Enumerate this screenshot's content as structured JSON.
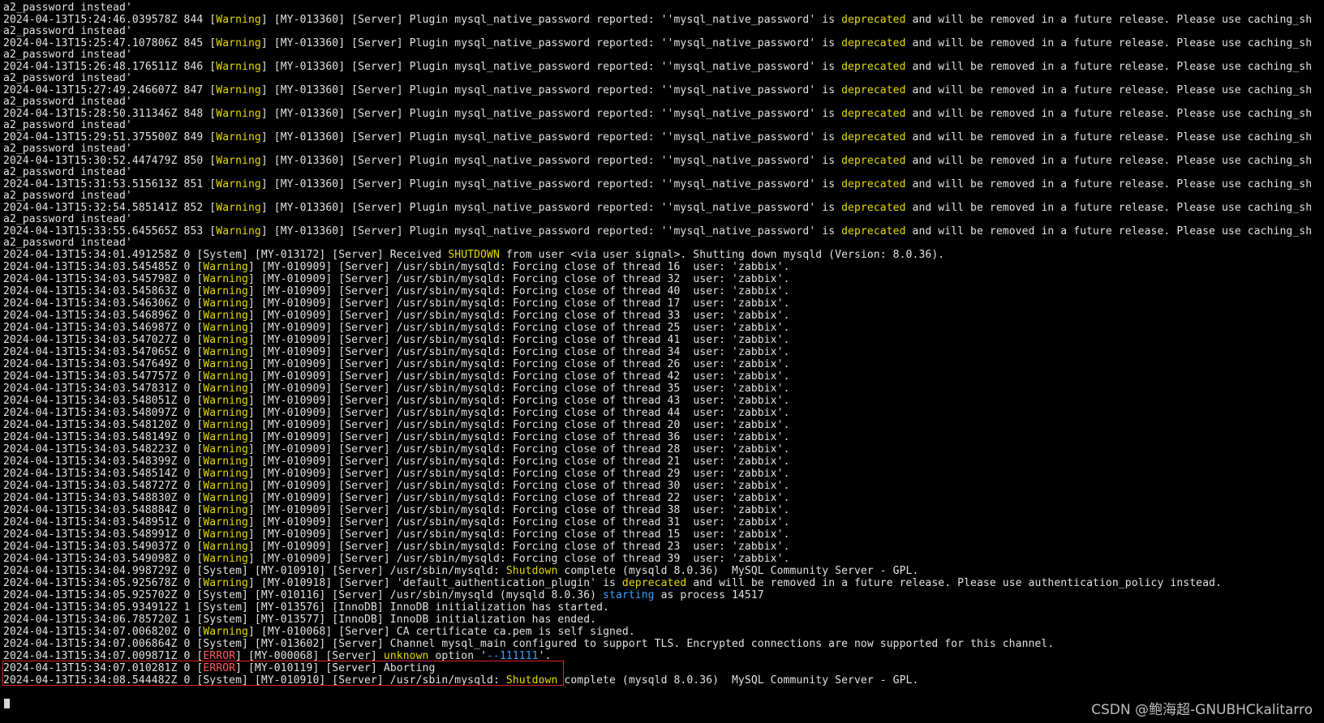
{
  "terminal": {
    "lines": [
      {
        "t": "a2_password instead'"
      },
      {
        "t": "2024-04-13T15:24:46.039578Z 844 [",
        "lvl": "Warning",
        "mid": "] [MY-013360] [Server] Plugin mysql_native_password reported: ''mysql_native_password' is ",
        "kw": "deprecated",
        "kwc": "y",
        "end": " and will be removed in a future release. Please use caching_sh",
        "wrap": true
      },
      {
        "t": "a2_password instead'"
      },
      {
        "t": "2024-04-13T15:25:47.107806Z 845 [",
        "lvl": "Warning",
        "mid": "] [MY-013360] [Server] Plugin mysql_native_password reported: ''mysql_native_password' is ",
        "kw": "deprecated",
        "kwc": "y",
        "end": " and will be removed in a future release. Please use caching_sh",
        "wrap": true
      },
      {
        "t": "a2_password instead'"
      },
      {
        "t": "2024-04-13T15:26:48.176511Z 846 [",
        "lvl": "Warning",
        "mid": "] [MY-013360] [Server] Plugin mysql_native_password reported: ''mysql_native_password' is ",
        "kw": "deprecated",
        "kwc": "y",
        "end": " and will be removed in a future release. Please use caching_sh",
        "wrap": true
      },
      {
        "t": "a2_password instead'"
      },
      {
        "t": "2024-04-13T15:27:49.246607Z 847 [",
        "lvl": "Warning",
        "mid": "] [MY-013360] [Server] Plugin mysql_native_password reported: ''mysql_native_password' is ",
        "kw": "deprecated",
        "kwc": "y",
        "end": " and will be removed in a future release. Please use caching_sh",
        "wrap": true
      },
      {
        "t": "a2_password instead'"
      },
      {
        "t": "2024-04-13T15:28:50.311346Z 848 [",
        "lvl": "Warning",
        "mid": "] [MY-013360] [Server] Plugin mysql_native_password reported: ''mysql_native_password' is ",
        "kw": "deprecated",
        "kwc": "y",
        "end": " and will be removed in a future release. Please use caching_sh",
        "wrap": true
      },
      {
        "t": "a2_password instead'"
      },
      {
        "t": "2024-04-13T15:29:51.375500Z 849 [",
        "lvl": "Warning",
        "mid": "] [MY-013360] [Server] Plugin mysql_native_password reported: ''mysql_native_password' is ",
        "kw": "deprecated",
        "kwc": "y",
        "end": " and will be removed in a future release. Please use caching_sh",
        "wrap": true
      },
      {
        "t": "a2_password instead'"
      },
      {
        "t": "2024-04-13T15:30:52.447479Z 850 [",
        "lvl": "Warning",
        "mid": "] [MY-013360] [Server] Plugin mysql_native_password reported: ''mysql_native_password' is ",
        "kw": "deprecated",
        "kwc": "y",
        "end": " and will be removed in a future release. Please use caching_sh",
        "wrap": true
      },
      {
        "t": "a2_password instead'"
      },
      {
        "t": "2024-04-13T15:31:53.515613Z 851 [",
        "lvl": "Warning",
        "mid": "] [MY-013360] [Server] Plugin mysql_native_password reported: ''mysql_native_password' is ",
        "kw": "deprecated",
        "kwc": "y",
        "end": " and will be removed in a future release. Please use caching_sh",
        "wrap": true
      },
      {
        "t": "a2_password instead'"
      },
      {
        "t": "2024-04-13T15:32:54.585141Z 852 [",
        "lvl": "Warning",
        "mid": "] [MY-013360] [Server] Plugin mysql_native_password reported: ''mysql_native_password' is ",
        "kw": "deprecated",
        "kwc": "y",
        "end": " and will be removed in a future release. Please use caching_sh",
        "wrap": true
      },
      {
        "t": "a2_password instead'"
      },
      {
        "t": "2024-04-13T15:33:55.645565Z 853 [",
        "lvl": "Warning",
        "mid": "] [MY-013360] [Server] Plugin mysql_native_password reported: ''mysql_native_password' is ",
        "kw": "deprecated",
        "kwc": "y",
        "end": " and will be removed in a future release. Please use caching_sh",
        "wrap": true
      },
      {
        "t": "a2_password instead'"
      },
      {
        "t": "2024-04-13T15:34:01.491258Z 0 [System] [MY-013172] [Server] Received ",
        "kw": "SHUTDOWN",
        "kwc": "y",
        "end": " from user <via user signal>. Shutting down mysqld (Version: 8.0.36)."
      },
      {
        "t": "2024-04-13T15:34:03.545485Z 0 [",
        "lvl": "Warning",
        "mid": "] [MY-010909] [Server] /usr/sbin/mysqld: Forcing close of thread 16  user: 'zabbix'."
      },
      {
        "t": "2024-04-13T15:34:03.545798Z 0 [",
        "lvl": "Warning",
        "mid": "] [MY-010909] [Server] /usr/sbin/mysqld: Forcing close of thread 32  user: 'zabbix'."
      },
      {
        "t": "2024-04-13T15:34:03.545863Z 0 [",
        "lvl": "Warning",
        "mid": "] [MY-010909] [Server] /usr/sbin/mysqld: Forcing close of thread 40  user: 'zabbix'."
      },
      {
        "t": "2024-04-13T15:34:03.546306Z 0 [",
        "lvl": "Warning",
        "mid": "] [MY-010909] [Server] /usr/sbin/mysqld: Forcing close of thread 17  user: 'zabbix'."
      },
      {
        "t": "2024-04-13T15:34:03.546896Z 0 [",
        "lvl": "Warning",
        "mid": "] [MY-010909] [Server] /usr/sbin/mysqld: Forcing close of thread 33  user: 'zabbix'."
      },
      {
        "t": "2024-04-13T15:34:03.546987Z 0 [",
        "lvl": "Warning",
        "mid": "] [MY-010909] [Server] /usr/sbin/mysqld: Forcing close of thread 25  user: 'zabbix'."
      },
      {
        "t": "2024-04-13T15:34:03.547027Z 0 [",
        "lvl": "Warning",
        "mid": "] [MY-010909] [Server] /usr/sbin/mysqld: Forcing close of thread 41  user: 'zabbix'."
      },
      {
        "t": "2024-04-13T15:34:03.547065Z 0 [",
        "lvl": "Warning",
        "mid": "] [MY-010909] [Server] /usr/sbin/mysqld: Forcing close of thread 34  user: 'zabbix'."
      },
      {
        "t": "2024-04-13T15:34:03.547649Z 0 [",
        "lvl": "Warning",
        "mid": "] [MY-010909] [Server] /usr/sbin/mysqld: Forcing close of thread 26  user: 'zabbix'."
      },
      {
        "t": "2024-04-13T15:34:03.547757Z 0 [",
        "lvl": "Warning",
        "mid": "] [MY-010909] [Server] /usr/sbin/mysqld: Forcing close of thread 42  user: 'zabbix'."
      },
      {
        "t": "2024-04-13T15:34:03.547831Z 0 [",
        "lvl": "Warning",
        "mid": "] [MY-010909] [Server] /usr/sbin/mysqld: Forcing close of thread 35  user: 'zabbix'."
      },
      {
        "t": "2024-04-13T15:34:03.548051Z 0 [",
        "lvl": "Warning",
        "mid": "] [MY-010909] [Server] /usr/sbin/mysqld: Forcing close of thread 43  user: 'zabbix'."
      },
      {
        "t": "2024-04-13T15:34:03.548097Z 0 [",
        "lvl": "Warning",
        "mid": "] [MY-010909] [Server] /usr/sbin/mysqld: Forcing close of thread 44  user: 'zabbix'."
      },
      {
        "t": "2024-04-13T15:34:03.548120Z 0 [",
        "lvl": "Warning",
        "mid": "] [MY-010909] [Server] /usr/sbin/mysqld: Forcing close of thread 20  user: 'zabbix'."
      },
      {
        "t": "2024-04-13T15:34:03.548149Z 0 [",
        "lvl": "Warning",
        "mid": "] [MY-010909] [Server] /usr/sbin/mysqld: Forcing close of thread 36  user: 'zabbix'."
      },
      {
        "t": "2024-04-13T15:34:03.548223Z 0 [",
        "lvl": "Warning",
        "mid": "] [MY-010909] [Server] /usr/sbin/mysqld: Forcing close of thread 28  user: 'zabbix'."
      },
      {
        "t": "2024-04-13T15:34:03.548399Z 0 [",
        "lvl": "Warning",
        "mid": "] [MY-010909] [Server] /usr/sbin/mysqld: Forcing close of thread 21  user: 'zabbix'."
      },
      {
        "t": "2024-04-13T15:34:03.548514Z 0 [",
        "lvl": "Warning",
        "mid": "] [MY-010909] [Server] /usr/sbin/mysqld: Forcing close of thread 29  user: 'zabbix'."
      },
      {
        "t": "2024-04-13T15:34:03.548727Z 0 [",
        "lvl": "Warning",
        "mid": "] [MY-010909] [Server] /usr/sbin/mysqld: Forcing close of thread 30  user: 'zabbix'."
      },
      {
        "t": "2024-04-13T15:34:03.548830Z 0 [",
        "lvl": "Warning",
        "mid": "] [MY-010909] [Server] /usr/sbin/mysqld: Forcing close of thread 22  user: 'zabbix'."
      },
      {
        "t": "2024-04-13T15:34:03.548884Z 0 [",
        "lvl": "Warning",
        "mid": "] [MY-010909] [Server] /usr/sbin/mysqld: Forcing close of thread 38  user: 'zabbix'."
      },
      {
        "t": "2024-04-13T15:34:03.548951Z 0 [",
        "lvl": "Warning",
        "mid": "] [MY-010909] [Server] /usr/sbin/mysqld: Forcing close of thread 31  user: 'zabbix'."
      },
      {
        "t": "2024-04-13T15:34:03.548991Z 0 [",
        "lvl": "Warning",
        "mid": "] [MY-010909] [Server] /usr/sbin/mysqld: Forcing close of thread 15  user: 'zabbix'."
      },
      {
        "t": "2024-04-13T15:34:03.549037Z 0 [",
        "lvl": "Warning",
        "mid": "] [MY-010909] [Server] /usr/sbin/mysqld: Forcing close of thread 23  user: 'zabbix'."
      },
      {
        "t": "2024-04-13T15:34:03.549098Z 0 [",
        "lvl": "Warning",
        "mid": "] [MY-010909] [Server] /usr/sbin/mysqld: Forcing close of thread 39  user: 'zabbix'."
      },
      {
        "t": "2024-04-13T15:34:04.998729Z 0 [System] [MY-010910] [Server] /usr/sbin/mysqld: ",
        "kw": "Shutdown",
        "kwc": "y",
        "end": " complete (mysqld 8.0.36)  MySQL Community Server - GPL."
      },
      {
        "t": "2024-04-13T15:34:05.925678Z 0 [",
        "lvl": "Warning",
        "mid": "] [MY-010918] [Server] 'default_authentication_plugin' is ",
        "kw": "deprecated",
        "kwc": "y",
        "end": " and will be removed in a future release. Please use authentication_policy instead."
      },
      {
        "t": "2024-04-13T15:34:05.925702Z 0 [System] [MY-010116] [Server] /usr/sbin/mysqld (mysqld 8.0.36) ",
        "kw": "starting",
        "kwc": "b",
        "end": " as process 14517"
      },
      {
        "t": "2024-04-13T15:34:05.934912Z 1 [System] [MY-013576] [InnoDB] InnoDB initialization has started."
      },
      {
        "t": "2024-04-13T15:34:06.785720Z 1 [System] [MY-013577] [InnoDB] InnoDB initialization has ended."
      },
      {
        "t": "2024-04-13T15:34:07.006820Z 0 [",
        "lvl": "Warning",
        "mid": "] [MY-010068] [Server] CA certificate ca.pem is self signed."
      },
      {
        "t": "2024-04-13T15:34:07.006864Z 0 [System] [MY-013602] [Server] Channel mysql_main configured to support TLS. Encrypted connections are now supported for this channel."
      },
      {
        "t": "2024-04-13T15:34:07.009871Z 0 [",
        "lvl": "ERROR",
        "lvlc": "e",
        "mid": "] [MY-000068] [Server] ",
        "kw": "unknown",
        "kwc": "y",
        "end": " option '",
        "kw2": "--111111",
        "kw2c": "b",
        "end2": "'."
      },
      {
        "t": "2024-04-13T15:34:07.010281Z 0 [",
        "lvl": "ERROR",
        "lvlc": "e",
        "mid": "] [MY-010119] [Server] Aborting"
      },
      {
        "t": "2024-04-13T15:34:08.544482Z 0 [System] [MY-010910] [Server] /usr/sbin/mysqld: ",
        "kw": "Shutdown",
        "kwc": "y",
        "end": " complete (mysqld 8.0.36)  MySQL Community Server - GPL."
      }
    ]
  },
  "watermark": "CSDN @鲍海超-GNUBHCkalitarro"
}
